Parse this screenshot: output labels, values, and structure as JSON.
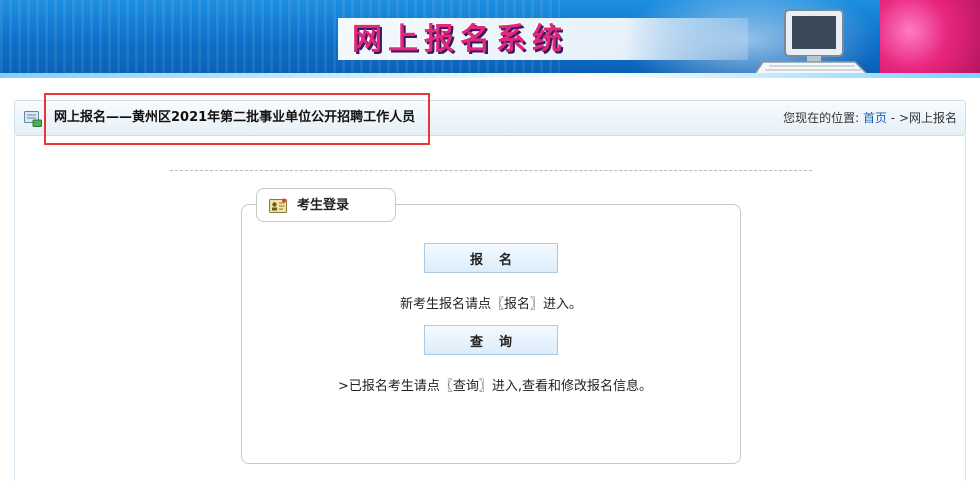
{
  "banner": {
    "title": "网上报名系统",
    "colors": {
      "background": "#0d6fc8",
      "title": "#e3287c",
      "accent": "#e8267e"
    }
  },
  "titlebar": {
    "icon": "doc-icon",
    "page_title": "网上报名——黄州区2021年第二批事业单位公开招聘工作人员",
    "location_prefix": "您现在的位置:",
    "home_link": "首页",
    "location_suffix": " - >网上报名"
  },
  "login": {
    "icon": "id-card-icon",
    "tab_label": "考生登录",
    "register_button": "报名",
    "register_note": "新考生报名请点〖报名〗进入。",
    "query_button": "查询",
    "query_note": ">已报名考生请点〖查询〗进入,查看和修改报名信息。"
  }
}
